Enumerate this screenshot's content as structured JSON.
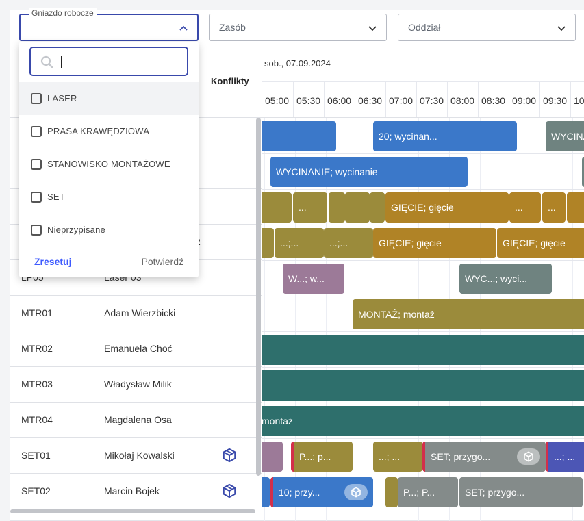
{
  "filters": {
    "workstation_label": "Gniazdo robocze",
    "workstation_value": "",
    "resource_label": "Zasób",
    "branch_label": "Oddział"
  },
  "dropdown": {
    "search_value": "",
    "options": [
      "LASER",
      "PRASA KRAWĘDZIOWA",
      "STANOWISKO MONTAŻOWE",
      "SET",
      "Nieprzypisane"
    ],
    "reset_label": "Zresetuj",
    "confirm_label": "Potwierdź"
  },
  "table": {
    "conflicts_header": "Konflikty",
    "date": "sob., 07.09.2024",
    "times": [
      "05:00",
      "05:30",
      "06:00",
      "06:30",
      "07:00",
      "07:30",
      "08:00",
      "08:30",
      "09:00",
      "09:30",
      "10:"
    ],
    "rows": [
      {
        "code": "LP05",
        "name": "Laser 03",
        "conflict": false
      },
      {
        "code": "MTR01",
        "name": "Adam Wierzbicki",
        "conflict": false
      },
      {
        "code": "MTR02",
        "name": "Emanuela Choć",
        "conflict": false
      },
      {
        "code": "MTR03",
        "name": "Władysław Milik",
        "conflict": false
      },
      {
        "code": "MTR04",
        "name": "Magdalena Osa",
        "conflict": false
      },
      {
        "code": "SET01",
        "name": "Mikołaj Kowalski",
        "conflict": true
      },
      {
        "code": "SET02",
        "name": "Marcin Bojek",
        "conflict": true
      }
    ],
    "partial_row_suffix": "2"
  },
  "tasks": {
    "r1_b2": "20; wycinan...",
    "r1_b3": "WYCINA",
    "r2_b1": "WYCINANIE; wycinanie",
    "r3_b2": "...",
    "r3_b6": "GIĘCIE; gięcie",
    "r3_b7": "...",
    "r3_b8": "...",
    "r4_b2": "...;...",
    "r4_b3": "...;...",
    "r4_b4": "GIĘCIE; gięcie",
    "r4_b5": "GIĘCIE; gięcie",
    "r5_b1": "W...; w...",
    "r5_b2": "WYC...; wyci...",
    "r6_b1": "MONTAŻ; montaż",
    "r9_b1": "montaż",
    "r10_b2": "P...; p...",
    "r10_b3": "...; ...",
    "r10_b4": "SET; przygo...",
    "r10_b5": "...; ...",
    "r11_b2": "10; przy...",
    "r11_b4": "P...; P...",
    "r11_b5": "SET; przygo..."
  },
  "colors": {
    "blue": "#3b78c9",
    "gray_teal": "#6f8380",
    "olive": "#9b8b3b",
    "gold": "#b08326",
    "mauve": "#9c7a98",
    "teal": "#2e6f6c",
    "gray": "#848b8a",
    "indigo": "#4c56b5",
    "conflict": "#d32f4a",
    "accent": "#3949ab"
  }
}
